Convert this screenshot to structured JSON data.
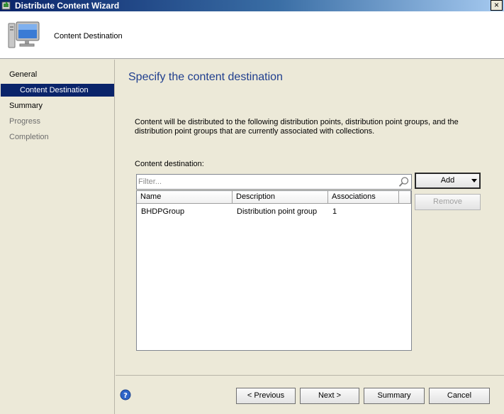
{
  "window": {
    "title": "Distribute Content Wizard",
    "close_glyph": "×",
    "icon": "wizard-app-icon"
  },
  "banner": {
    "title": "Content Destination",
    "icon": "computer-monitor-icon"
  },
  "nav": {
    "items": [
      {
        "label": "General",
        "state": "normal"
      },
      {
        "label": "Content Destination",
        "state": "selected"
      },
      {
        "label": "Summary",
        "state": "normal"
      },
      {
        "label": "Progress",
        "state": "disabled"
      },
      {
        "label": "Completion",
        "state": "disabled"
      }
    ]
  },
  "main": {
    "heading": "Specify the content destination",
    "description": "Content will be distributed to the following distribution points, distribution point groups, and the distribution point groups that are currently associated with collections.",
    "content_label": "Content destination:",
    "filter": {
      "value": "",
      "placeholder": "Filter..."
    },
    "table": {
      "columns": [
        "Name",
        "Description",
        "Associations"
      ],
      "rows": [
        {
          "name": "BHDPGroup",
          "description": "Distribution point group",
          "associations": "1"
        }
      ]
    },
    "add_label": "Add",
    "remove_label": "Remove"
  },
  "footer": {
    "previous_label": "< Previous",
    "next_label": "Next >",
    "summary_label": "Summary",
    "cancel_label": "Cancel"
  },
  "colors": {
    "selection": "#0a246a",
    "heading": "#1f3e8e",
    "panel": "#ece9d8"
  }
}
